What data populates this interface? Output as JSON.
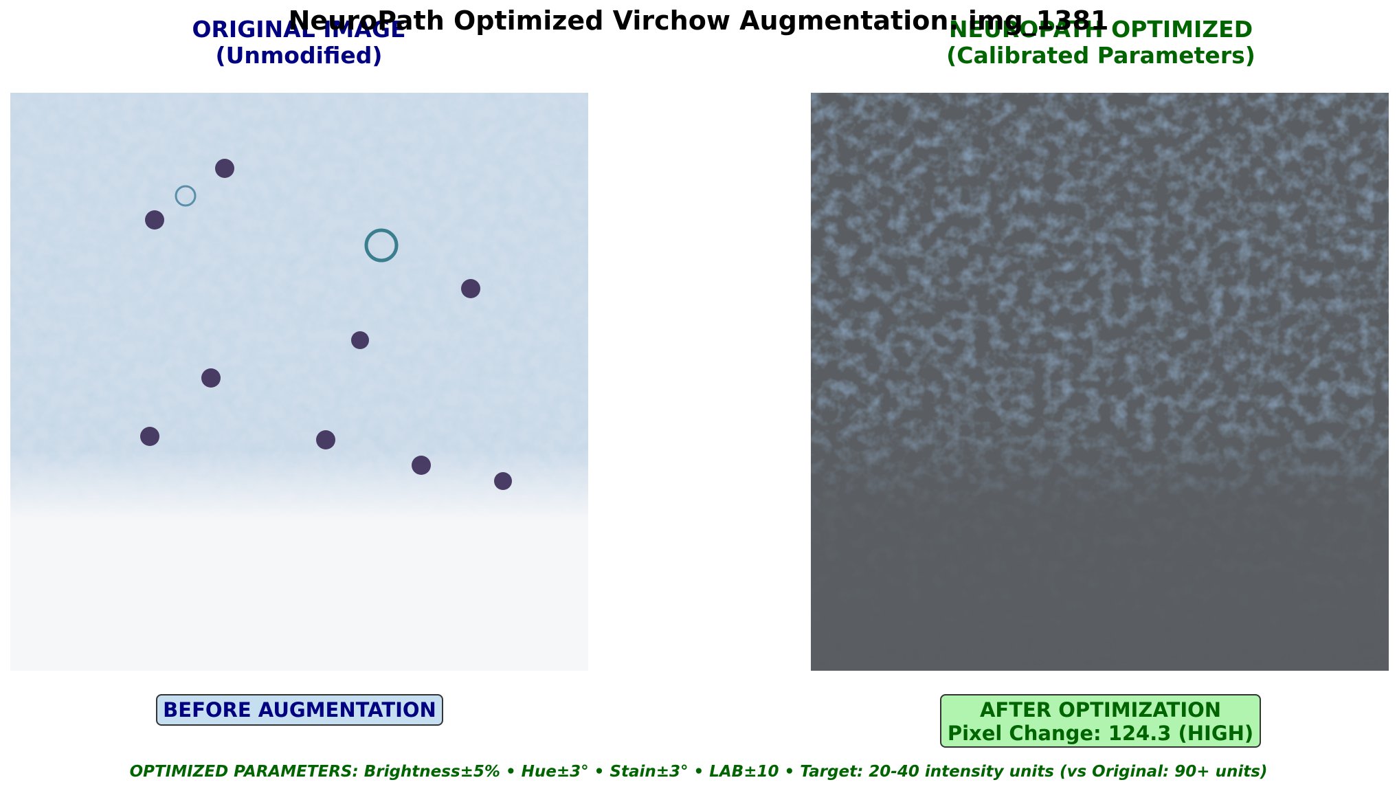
{
  "figure": {
    "title": "NeuroPath Optimized Virchow Augmentation: img_1381"
  },
  "left_panel": {
    "title_line1": "ORIGINAL IMAGE",
    "title_line2": "(Unmodified)",
    "badge": "BEFORE AUGMENTATION",
    "colors": {
      "title": "#000080",
      "badge_bg": "#c5dff0",
      "tissue": "#8fb0cc",
      "nucleus": "#3a2a55",
      "background": "#f6f7f9"
    }
  },
  "right_panel": {
    "title_line1": "NEUROPATH OPTIMIZED",
    "title_line2": "(Calibrated Parameters)",
    "badge_line1": "AFTER OPTIMIZATION",
    "badge_line2": "Pixel Change: 124.3 (HIGH)",
    "colors": {
      "title": "#006400",
      "badge_bg": "#b0f4b0",
      "fill": "#5a5e62",
      "tissue": "#3f5c7e"
    }
  },
  "footer": {
    "text": "OPTIMIZED PARAMETERS: Brightness±5% • Hue±3° • Stain±3° • LAB±10 • Target: 20-40 intensity units (vs Original: 90+ units)"
  }
}
